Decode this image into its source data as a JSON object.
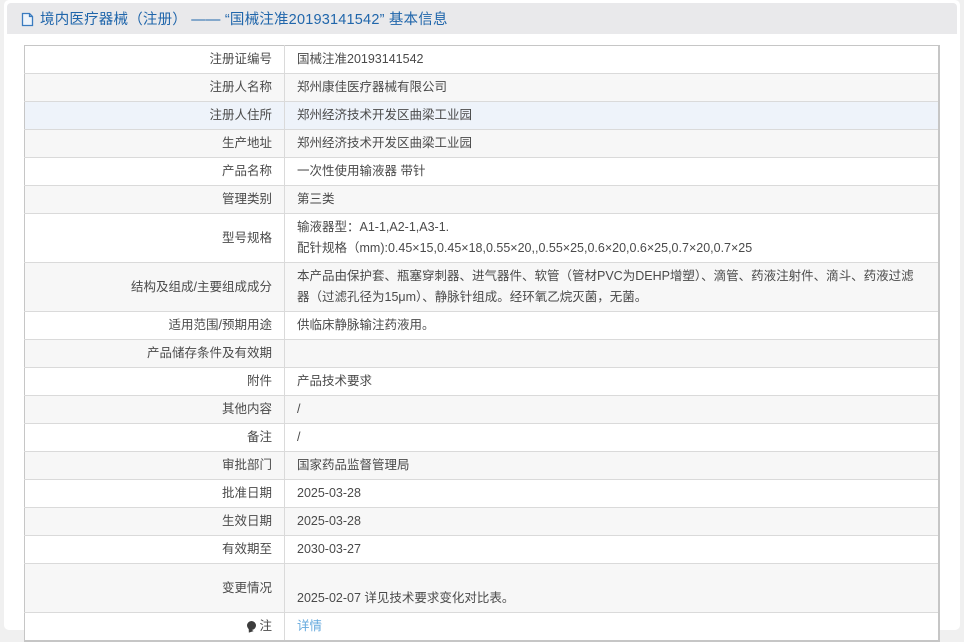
{
  "colors": {
    "title_blue": "#2066ab",
    "link_blue": "#65a9dd",
    "even_row_bg": "#f7f7f7",
    "hover_row_bg": "#eef3fa",
    "titlebar_bg": "#e9e9eb"
  },
  "header": {
    "icon": "document-icon",
    "title": "境内医疗器械（注册） —— “国械注准20193141542” 基本信息"
  },
  "table": {
    "rows": [
      {
        "label": "注册证编号",
        "value": "国械注准20193141542"
      },
      {
        "label": "注册人名称",
        "value": "郑州康佳医疗器械有限公司"
      },
      {
        "label": "注册人住所",
        "value": "郑州经济技术开发区曲梁工业园",
        "hovered": true
      },
      {
        "label": "生产地址",
        "value": "郑州经济技术开发区曲梁工业园"
      },
      {
        "label": "产品名称",
        "value": "一次性使用输液器 带针"
      },
      {
        "label": "管理类别",
        "value": "第三类"
      },
      {
        "label": "型号规格",
        "value": "输液器型：A1-1,A2-1,A3-1.\n配针规格（mm):0.45×15,0.45×18,0.55×20,,0.55×25,0.6×20,0.6×25,0.7×20,0.7×25"
      },
      {
        "label": "结构及组成/主要组成成分",
        "value": "本产品由保护套、瓶塞穿刺器、进气器件、软管（管材PVC为DEHP增塑）、滴管、药液注射件、滴斗、药液过滤器（过滤孔径为15μm）、静脉针组成。经环氧乙烷灭菌，无菌。"
      },
      {
        "label": "适用范围/预期用途",
        "value": "供临床静脉输注药液用。"
      },
      {
        "label": "产品储存条件及有效期",
        "value": ""
      },
      {
        "label": "附件",
        "value": "产品技术要求"
      },
      {
        "label": "其他内容",
        "value": "/"
      },
      {
        "label": "备注",
        "value": "/"
      },
      {
        "label": "审批部门",
        "value": "国家药品监督管理局"
      },
      {
        "label": "批准日期",
        "value": "2025-03-28"
      },
      {
        "label": "生效日期",
        "value": "2025-03-28"
      },
      {
        "label": "有效期至",
        "value": "2030-03-27"
      },
      {
        "label": "变更情况",
        "value": "\n2025-02-07 详见技术要求变化对比表。"
      },
      {
        "label": "注",
        "value": "详情",
        "note_icon": true,
        "link": true
      }
    ]
  }
}
